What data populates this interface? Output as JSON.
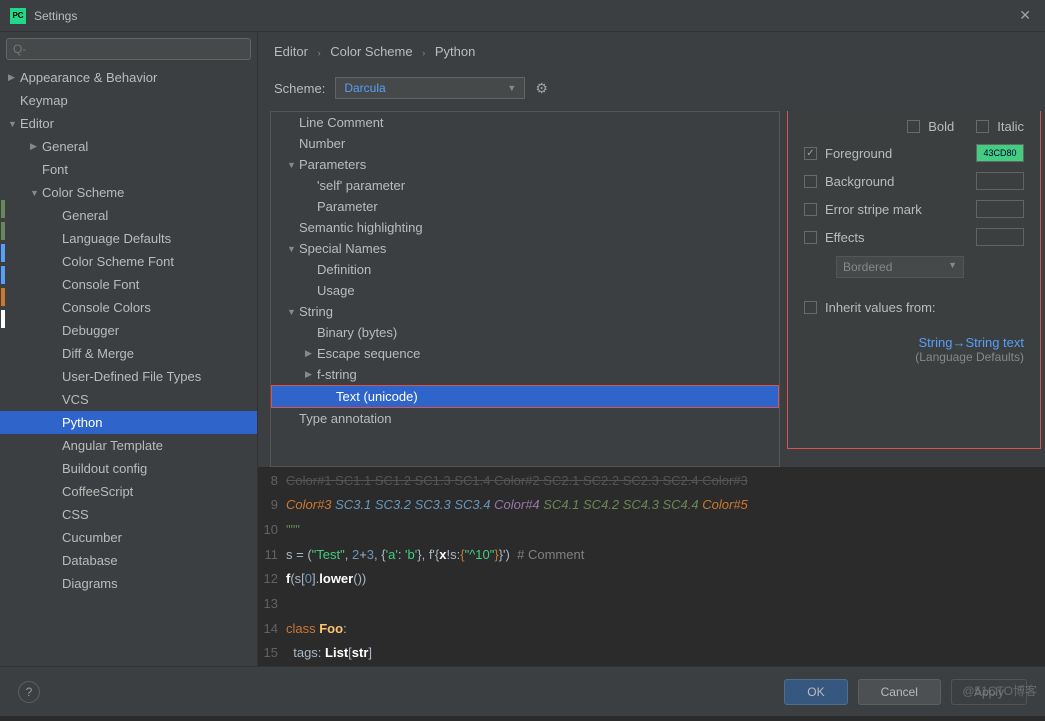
{
  "titlebar": {
    "title": "Settings",
    "close": "✕"
  },
  "search": {
    "placeholder": "Q-"
  },
  "nav": [
    {
      "label": "Appearance & Behavior",
      "depth": 0,
      "arrow": "▶"
    },
    {
      "label": "Keymap",
      "depth": 0,
      "arrow": ""
    },
    {
      "label": "Editor",
      "depth": 0,
      "arrow": "▼"
    },
    {
      "label": "General",
      "depth": 1,
      "arrow": "▶"
    },
    {
      "label": "Font",
      "depth": 1,
      "arrow": ""
    },
    {
      "label": "Color Scheme",
      "depth": 1,
      "arrow": "▼"
    },
    {
      "label": "General",
      "depth": 2,
      "arrow": ""
    },
    {
      "label": "Language Defaults",
      "depth": 2,
      "arrow": ""
    },
    {
      "label": "Color Scheme Font",
      "depth": 2,
      "arrow": ""
    },
    {
      "label": "Console Font",
      "depth": 2,
      "arrow": ""
    },
    {
      "label": "Console Colors",
      "depth": 2,
      "arrow": ""
    },
    {
      "label": "Debugger",
      "depth": 2,
      "arrow": ""
    },
    {
      "label": "Diff & Merge",
      "depth": 2,
      "arrow": ""
    },
    {
      "label": "User-Defined File Types",
      "depth": 2,
      "arrow": ""
    },
    {
      "label": "VCS",
      "depth": 2,
      "arrow": ""
    },
    {
      "label": "Python",
      "depth": 2,
      "arrow": "",
      "selected": true
    },
    {
      "label": "Angular Template",
      "depth": 2,
      "arrow": ""
    },
    {
      "label": "Buildout config",
      "depth": 2,
      "arrow": ""
    },
    {
      "label": "CoffeeScript",
      "depth": 2,
      "arrow": ""
    },
    {
      "label": "CSS",
      "depth": 2,
      "arrow": ""
    },
    {
      "label": "Cucumber",
      "depth": 2,
      "arrow": ""
    },
    {
      "label": "Database",
      "depth": 2,
      "arrow": ""
    },
    {
      "label": "Diagrams",
      "depth": 2,
      "arrow": ""
    }
  ],
  "breadcrumb": {
    "a": "Editor",
    "b": "Color Scheme",
    "c": "Python"
  },
  "scheme": {
    "label": "Scheme:",
    "value": "Darcula"
  },
  "attrs": [
    {
      "label": "Line Comment",
      "depth": 0,
      "arrow": ""
    },
    {
      "label": "Number",
      "depth": 0,
      "arrow": ""
    },
    {
      "label": "Parameters",
      "depth": 0,
      "arrow": "▼"
    },
    {
      "label": "'self' parameter",
      "depth": 1,
      "arrow": ""
    },
    {
      "label": "Parameter",
      "depth": 1,
      "arrow": ""
    },
    {
      "label": "Semantic highlighting",
      "depth": 0,
      "arrow": ""
    },
    {
      "label": "Special Names",
      "depth": 0,
      "arrow": "▼"
    },
    {
      "label": "Definition",
      "depth": 1,
      "arrow": ""
    },
    {
      "label": "Usage",
      "depth": 1,
      "arrow": ""
    },
    {
      "label": "String",
      "depth": 0,
      "arrow": "▼"
    },
    {
      "label": "Binary (bytes)",
      "depth": 1,
      "arrow": ""
    },
    {
      "label": "Escape sequence",
      "depth": 1,
      "arrow": "▶"
    },
    {
      "label": "f-string",
      "depth": 1,
      "arrow": "▶"
    },
    {
      "label": "Text (unicode)",
      "depth": 2,
      "arrow": "",
      "selected": true,
      "red": true
    },
    {
      "label": "Type annotation",
      "depth": 0,
      "arrow": ""
    }
  ],
  "opts": {
    "bold": "Bold",
    "italic": "Italic",
    "foreground": "Foreground",
    "background": "Background",
    "error": "Error stripe mark",
    "effects": "Effects",
    "effects_value": "Bordered",
    "inherit": "Inherit values from:",
    "link": "String→String text",
    "note": "(Language Defaults)",
    "fg_color": "#43CD80",
    "fg_label": "43CD80"
  },
  "code": {
    "l8": "Color#1 SC1.1 SC1.2 SC1.3 SC1.4 Color#2 SC2.1 SC2.2 SC2.3 SC2.4 Color#3",
    "l9": {
      "a": "Color#3 ",
      "b": "SC3.1 SC3.2 SC3.3 SC3.4 ",
      "c": "Color#4 ",
      "d": "SC4.1 SC4.2 SC4.3 SC4.4 ",
      "e": "Color#5"
    },
    "l10": "\"\"\"",
    "l11": {
      "a": "s = (",
      "b": "\"Test\"",
      "c": ", ",
      "d": "2",
      "e": "+",
      "f": "3",
      "g": ", {",
      "h": "'a'",
      "i": ": ",
      "j": "'b'",
      "k": "}, f'{",
      "l": "x",
      "m": "!s:",
      "n": "{",
      "o": "\"^10\"",
      "p": "}",
      "q": "}')  ",
      "r": "# Comment"
    },
    "l12": {
      "a": "f",
      "b": "(s[",
      "c": "0",
      "d": "].",
      "e": "lower",
      "f": "())"
    },
    "l14": {
      "a": "class ",
      "b": "Foo",
      "c": ":"
    },
    "l15": {
      "a": "  tags: ",
      "b": "List",
      "c": "[",
      "d": "str",
      "e": "]"
    }
  },
  "buttons": {
    "ok": "OK",
    "cancel": "Cancel",
    "apply": "Apply",
    "help": "?"
  },
  "watermark": "@51CTO博客"
}
